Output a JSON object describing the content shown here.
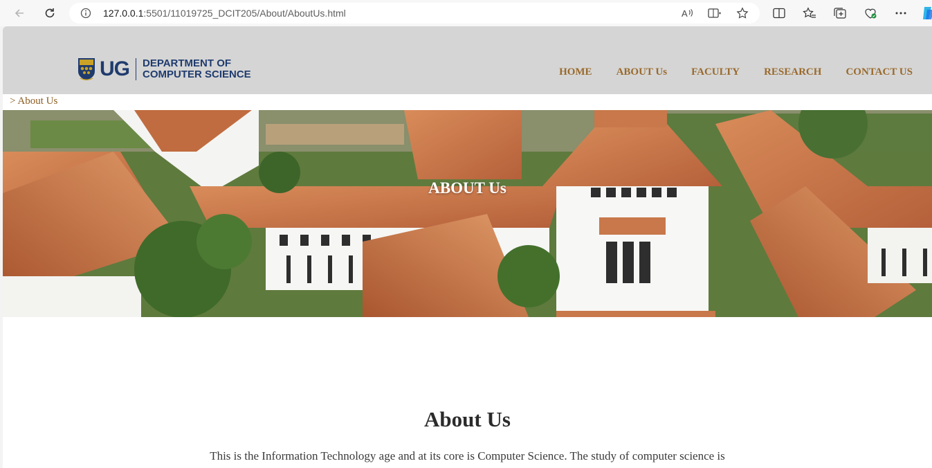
{
  "browser": {
    "url_host": "127.0.0.1",
    "url_rest": ":5501/11019725_DCIT205/About/AboutUs.html"
  },
  "site": {
    "logo_short": "UG",
    "logo_line1": "DEPARTMENT OF",
    "logo_line2": "COMPUTER SCIENCE",
    "nav": {
      "home": "HOME",
      "about": "ABOUT Us",
      "faculty": "FACULTY",
      "research": "RESEARCH",
      "contact": "CONTACT US"
    },
    "breadcrumb": "> About Us",
    "hero_title": "ABOUT Us",
    "section_title": "About Us",
    "intro_text": "This is the Information Technology age and at its core is Computer Science. The study of computer science is"
  },
  "colors": {
    "brand_navy": "#1f3b6e",
    "nav_gold": "#9a6a2c",
    "header_bg": "#d5d5d5"
  }
}
